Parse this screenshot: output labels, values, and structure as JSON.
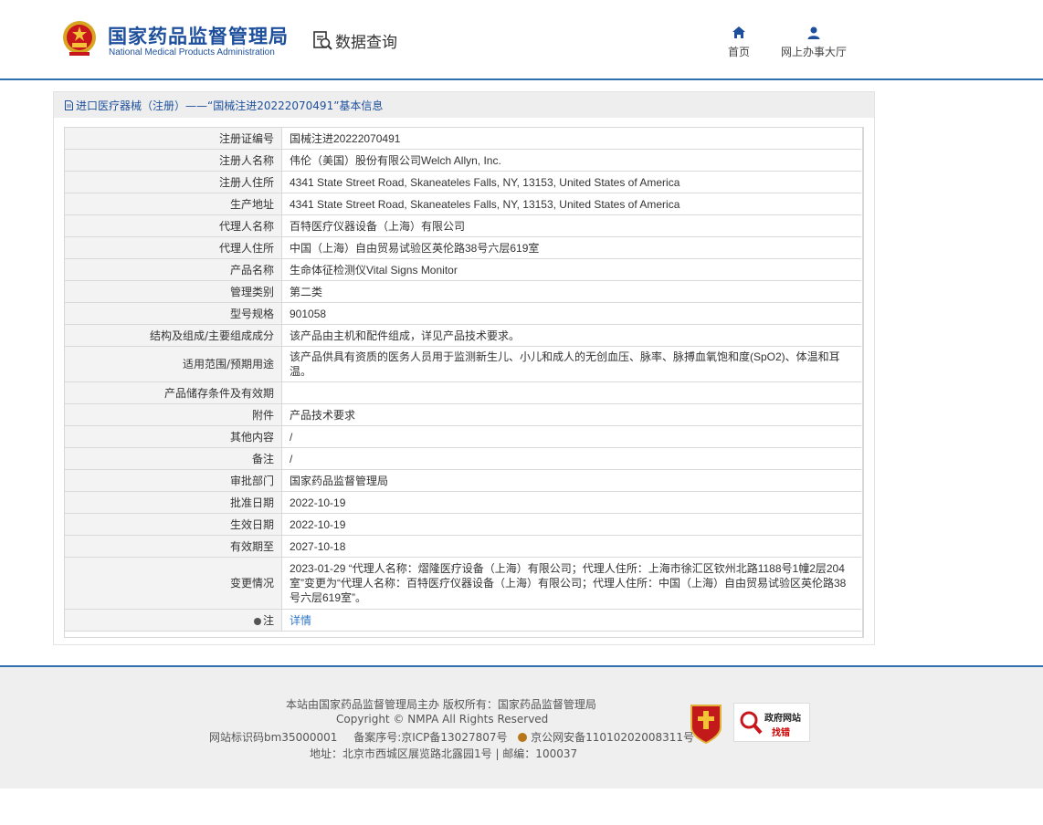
{
  "header": {
    "org_name_cn": "国家药品监督管理局",
    "org_name_en": "National Medical Products Administration",
    "query_label": "数据查询",
    "nav": [
      {
        "label": "首页",
        "icon": "home-icon"
      },
      {
        "label": "网上办事大厅",
        "icon": "user-icon"
      }
    ]
  },
  "panel": {
    "title": "进口医疗器械（注册）——“国械注进20222070491”基本信息",
    "rows": [
      {
        "key": "注册证编号",
        "value": "国械注进20222070491"
      },
      {
        "key": "注册人名称",
        "value": "伟伦（美国）股份有限公司Welch Allyn, Inc."
      },
      {
        "key": "注册人住所",
        "value": "4341 State Street Road, Skaneateles Falls, NY, 13153, United States of America"
      },
      {
        "key": "生产地址",
        "value": "4341 State Street Road, Skaneateles Falls, NY, 13153, United States of America"
      },
      {
        "key": "代理人名称",
        "value": "百特医疗仪器设备（上海）有限公司"
      },
      {
        "key": "代理人住所",
        "value": "中国（上海）自由贸易试验区英伦路38号六层619室"
      },
      {
        "key": "产品名称",
        "value": "生命体征检测仪Vital Signs Monitor"
      },
      {
        "key": "管理类别",
        "value": "第二类"
      },
      {
        "key": "型号规格",
        "value": "901058"
      },
      {
        "key": "结构及组成/主要组成成分",
        "value": "该产品由主机和配件组成，详见产品技术要求。"
      },
      {
        "key": "适用范围/预期用途",
        "value": "该产品供具有资质的医务人员用于监测新生儿、小儿和成人的无创血压、脉率、脉搏血氧饱和度(SpO2)、体温和耳温。"
      },
      {
        "key": "产品储存条件及有效期",
        "value": ""
      },
      {
        "key": "附件",
        "value": "产品技术要求"
      },
      {
        "key": "其他内容",
        "value": "/"
      },
      {
        "key": "备注",
        "value": "/"
      },
      {
        "key": "审批部门",
        "value": "国家药品监督管理局"
      },
      {
        "key": "批准日期",
        "value": "2022-10-19"
      },
      {
        "key": "生效日期",
        "value": "2022-10-19"
      },
      {
        "key": "有效期至",
        "value": "2027-10-18"
      },
      {
        "key": "变更情况",
        "value": "2023-01-29 “代理人名称：熠隆医疗设备（上海）有限公司；代理人住所：上海市徐汇区钦州北路1188号1幢2层204室”变更为“代理人名称：百特医疗仪器设备（上海）有限公司；代理人住所：中国（上海）自由贸易试验区英伦路38号六层619室”。"
      }
    ],
    "note_key": "注",
    "note_link": "详情"
  },
  "footer": {
    "line1": "本站由国家药品监督管理局主办 版权所有：国家药品监督管理局",
    "line2": "Copyright © NMPA All Rights Reserved",
    "line3a": "网站标识码bm35000001",
    "line3b": "备案序号:京ICP备13027807号",
    "line3c": "京公网安备11010202008311号",
    "line4": "地址：北京市西城区展览路北露园1号 | 邮编：100037",
    "badge_gov_title": "政府网站",
    "badge_gov_find": "找错",
    "badge_party": "党政机关"
  },
  "colors": {
    "brand_blue": "#1d4f9c",
    "rule_blue": "#2f6fb0",
    "link": "#2f77c7"
  }
}
